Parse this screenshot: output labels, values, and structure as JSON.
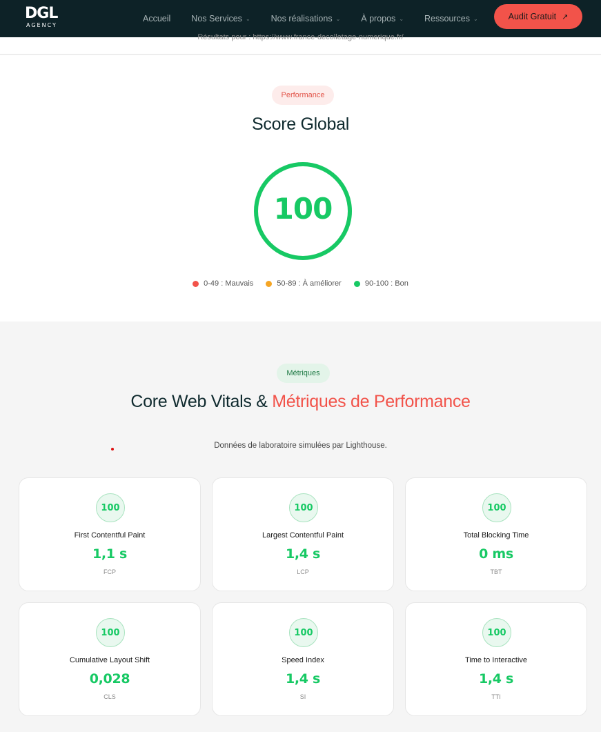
{
  "nav": {
    "logo_main": "DGL",
    "logo_sub": "AGENCY",
    "links": [
      {
        "label": "Accueil",
        "has_menu": false
      },
      {
        "label": "Nos Services",
        "has_menu": true
      },
      {
        "label": "Nos réalisations",
        "has_menu": true
      },
      {
        "label": "À propos",
        "has_menu": true
      },
      {
        "label": "Ressources",
        "has_menu": true
      }
    ],
    "cta_label": "Audit Gratuit",
    "cta_icon": "arrow-up-right-icon"
  },
  "results_text": "Résultats pour : https://www.france-decolletage-numerique.fr/",
  "score_section": {
    "badge": "Performance",
    "title": "Score Global",
    "score": "100",
    "score_fraction": 1.0,
    "legend": [
      {
        "label": "0-49 : Mauvais",
        "color": "#f2534a"
      },
      {
        "label": "50-89 : À améliorer",
        "color": "#f5a524"
      },
      {
        "label": "90-100 : Bon",
        "color": "#17c964"
      }
    ]
  },
  "metrics_section": {
    "badge": "Métriques",
    "title_part1": "Core Web Vitals & ",
    "title_part2": "Métriques de Performance",
    "subtitle": "Données de laboratoire simulées par Lighthouse.",
    "cards": [
      {
        "score": "100",
        "title": "First Contentful Paint",
        "value": "1,1 s",
        "abbr": "FCP"
      },
      {
        "score": "100",
        "title": "Largest Contentful Paint",
        "value": "1,4 s",
        "abbr": "LCP"
      },
      {
        "score": "100",
        "title": "Total Blocking Time",
        "value": "0 ms",
        "abbr": "TBT"
      },
      {
        "score": "100",
        "title": "Cumulative Layout Shift",
        "value": "0,028",
        "abbr": "CLS"
      },
      {
        "score": "100",
        "title": "Speed Index",
        "value": "1,4 s",
        "abbr": "SI"
      },
      {
        "score": "100",
        "title": "Time to Interactive",
        "value": "1,4 s",
        "abbr": "TTI"
      }
    ]
  },
  "colors": {
    "nav_bg": "#0d2227",
    "accent": "#f2534a",
    "good": "#17c964"
  }
}
